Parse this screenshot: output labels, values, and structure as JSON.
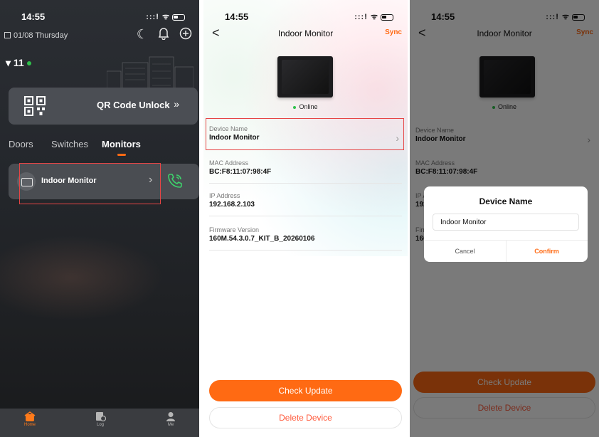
{
  "status_bar": {
    "time": "14:55",
    "icons": ":::! ᯤ"
  },
  "home": {
    "date": "01/08 Thursday",
    "location": "11",
    "qr_label": "QR Code Unlock",
    "qr_arrow": "»",
    "tabs": [
      "Doors",
      "Switches",
      "Monitors"
    ],
    "active_tab": "Monitors",
    "device": {
      "name": "Indoor Monitor"
    },
    "bottom_tabs": [
      "Home",
      "Log",
      "Me"
    ],
    "accent": "#ff6a13"
  },
  "detail": {
    "back": "<",
    "title": "Indoor Monitor",
    "sync": "Sync",
    "online": "Online",
    "fields": [
      {
        "label": "Device Name",
        "value": "Indoor Monitor"
      },
      {
        "label": "MAC Address",
        "value": "BC:F8:11:07:98:4F"
      },
      {
        "label": "IP Address",
        "value": "192.168.2.103"
      },
      {
        "label": "Firmware Version",
        "value": "160M.54.3.0.7_KIT_B_20260106"
      }
    ],
    "check_update": "Check Update",
    "delete_device": "Delete Device"
  },
  "dialog": {
    "title": "Device Name",
    "input_value": "Indoor Monitor",
    "cancel": "Cancel",
    "confirm": "Confirm"
  }
}
